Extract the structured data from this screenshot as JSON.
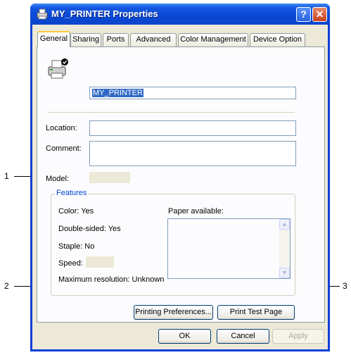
{
  "window": {
    "title": "MY_PRINTER Properties",
    "help_label": "?",
    "close_label": "✕"
  },
  "tabs": [
    {
      "label": "General",
      "active": true
    },
    {
      "label": "Sharing"
    },
    {
      "label": "Ports"
    },
    {
      "label": "Advanced"
    },
    {
      "label": "Color Management"
    },
    {
      "label": "Device Option"
    }
  ],
  "general": {
    "printer_name": "MY_PRINTER",
    "location_label": "Location:",
    "location_value": "",
    "comment_label": "Comment:",
    "comment_value": "",
    "model_label": "Model:",
    "model_value": ""
  },
  "features": {
    "title": "Features",
    "color": "Color: Yes",
    "double_sided": "Double-sided: Yes",
    "staple": "Staple: No",
    "speed": "Speed:",
    "max_resolution": "Maximum resolution: Unknown",
    "paper_label": "Paper available:",
    "paper_items": []
  },
  "buttons": {
    "printing_preferences": "Printing Preferences...",
    "print_test_page": "Print Test Page",
    "ok": "OK",
    "cancel": "Cancel",
    "apply": "Apply"
  },
  "callouts": {
    "c1": "1",
    "c2": "2",
    "c3": "3"
  }
}
